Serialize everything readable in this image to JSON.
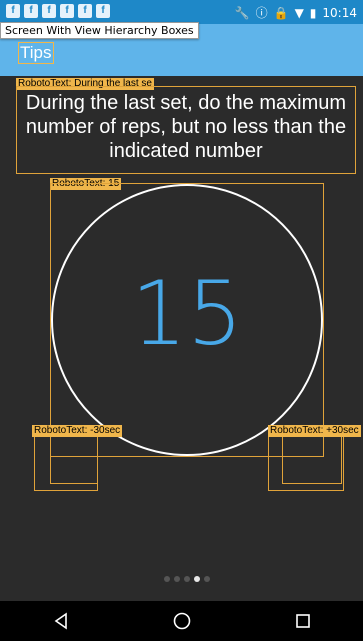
{
  "status": {
    "time": "10:14",
    "left_icons": [
      "f",
      "f",
      "f",
      "f",
      "f",
      "f"
    ],
    "colors": {
      "statusbar": "#1e88c8"
    }
  },
  "overlay_label": "Screen With View Hierarchy Boxes",
  "app": {
    "title": "Tips",
    "colors": {
      "appbar": "#5fb4ea",
      "accent": "#48a8e8"
    }
  },
  "tip": {
    "debug_label": "RobotoText: During the last se",
    "text": "During the last set, do the maximum number of reps, but no less than the indicated number"
  },
  "count": {
    "debug_label": "RobotoText: 15",
    "value": "15"
  },
  "stepper": {
    "minus_label": "RobotoText: -30sec",
    "plus_label": "RobotoText: +30sec"
  },
  "pager": {
    "total": 5,
    "active_index": 3
  },
  "nav": {
    "back_icon": "back-triangle-icon",
    "home_icon": "home-circle-icon",
    "recent_icon": "recent-square-icon"
  }
}
